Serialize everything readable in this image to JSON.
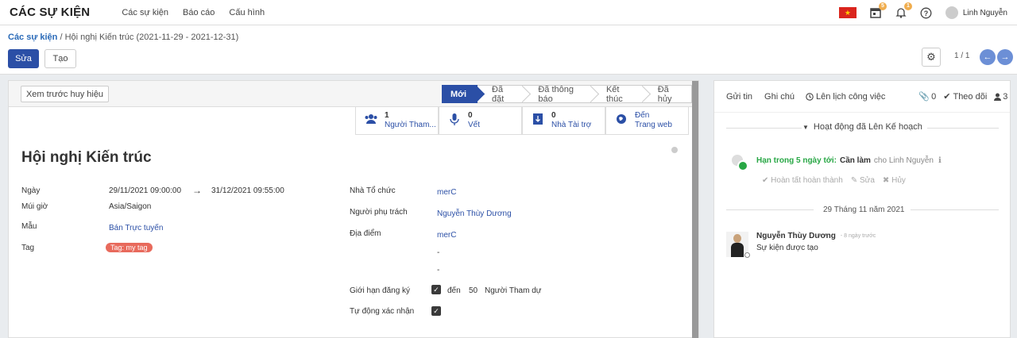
{
  "navbar": {
    "brand": "CÁC SỰ KIỆN",
    "menu": [
      "Các sự kiện",
      "Báo cáo",
      "Cấu hình"
    ],
    "activity_badge": "5",
    "notification_badge": "1",
    "user_name": "Linh Nguyễn"
  },
  "control": {
    "breadcrumb_root": "Các sự kiện",
    "breadcrumb_sep": "/",
    "breadcrumb_current": "Hội nghị Kiến trúc (2021-11-29 - 2021-12-31)",
    "edit_label": "Sửa",
    "create_label": "Tạo",
    "pager": "1 / 1"
  },
  "form": {
    "preview_badge_label": "Xem trước huy hiệu",
    "stages": [
      "Mới",
      "Đã đặt",
      "Đã thông báo",
      "Kết thúc",
      "Đã hủy"
    ],
    "active_stage": "Mới",
    "smart_buttons": [
      {
        "num": "1",
        "label": "Người Tham...",
        "icon": "users-icon"
      },
      {
        "num": "0",
        "label": "Vết",
        "icon": "microphone-icon"
      },
      {
        "num": "0",
        "label": "Nhà Tài trợ",
        "icon": "sponsor-icon"
      },
      {
        "num": "Đến",
        "label": "Trang web",
        "icon": "globe-icon"
      }
    ],
    "title": "Hội nghị Kiến trúc",
    "date_label": "Ngày",
    "date_start": "29/11/2021 09:00:00",
    "date_arrow": "→",
    "date_end": "31/12/2021 09:55:00",
    "timezone_label": "Múi giờ",
    "timezone": "Asia/Saigon",
    "template_label": "Mẫu",
    "template": "Bán Trực tuyến",
    "tag_label": "Tag",
    "tag": "Tag: my tag",
    "organizer_label": "Nhà Tổ chức",
    "organizer": "merC",
    "responsible_label": "Người phụ trách",
    "responsible": "Nguyễn Thùy Dương",
    "location_label": "Địa điểm",
    "location": "merC",
    "address_line1": "-",
    "address_line2": "-",
    "limit_label": "Giới hạn đăng ký",
    "limit_to": "đến",
    "limit_value": "50",
    "limit_unit": "Người Tham dự",
    "auto_confirm_label": "Tự động xác nhận"
  },
  "chatter": {
    "send_message": "Gửi tin",
    "log_note": "Ghi chú",
    "schedule_activity": "Lên lịch công việc",
    "attachments": "0",
    "follow": "Theo dõi",
    "followers": "3",
    "planned_header": "Hoạt động đã Lên Kế hoạch",
    "activity_due": "Hạn trong 5 ngày tới:",
    "activity_type": "Cần làm",
    "activity_for": "cho Linh Nguyễn",
    "mark_done": "Hoàn tất hoàn thành",
    "edit": "Sửa",
    "cancel": "Hủy",
    "date_separator": "29 Tháng 11 năm 2021",
    "msg_author": "Nguyễn Thùy Dương",
    "msg_time": "- 8 ngày trước",
    "msg_body": "Sự kiện được tạo"
  },
  "colors": {
    "primary": "#2b4fa6",
    "tag": "#e86a5c",
    "activity_green": "#28a745"
  }
}
